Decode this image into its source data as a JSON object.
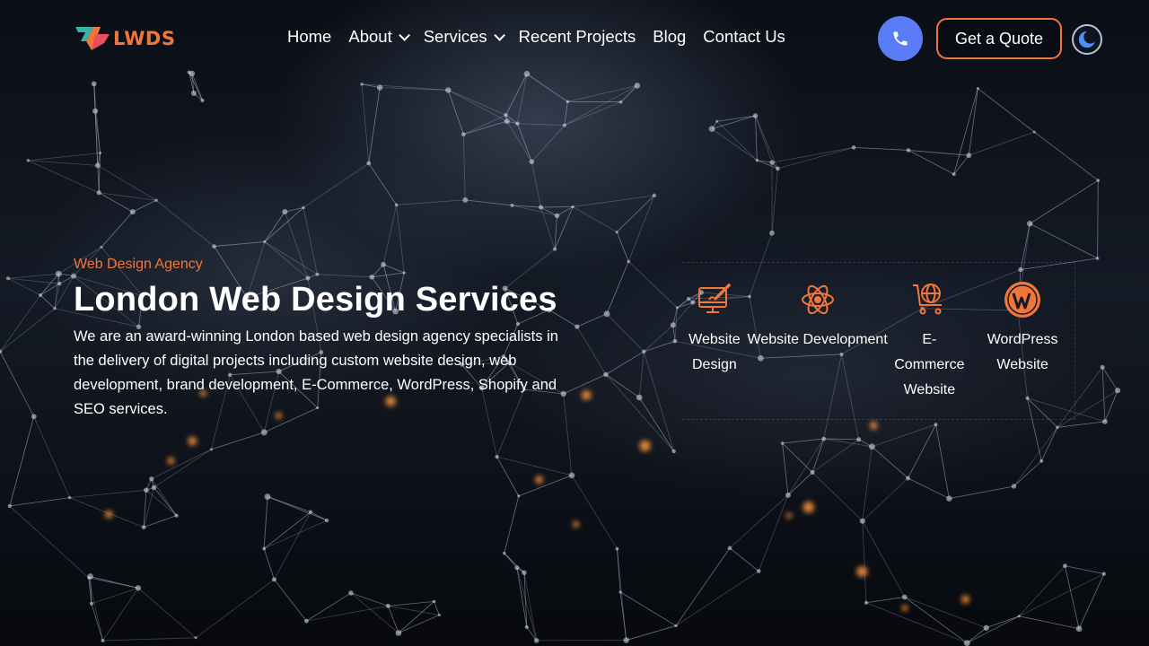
{
  "brand": {
    "name": "LWDS",
    "accent": "#f2763a",
    "phone_color": "#5a7cf6"
  },
  "nav": {
    "items": [
      {
        "label": "Home",
        "dropdown": false
      },
      {
        "label": "About",
        "dropdown": true
      },
      {
        "label": "Services",
        "dropdown": true
      },
      {
        "label": "Recent Projects",
        "dropdown": false
      },
      {
        "label": "Blog",
        "dropdown": false
      },
      {
        "label": "Contact Us",
        "dropdown": false
      }
    ]
  },
  "header": {
    "phone_icon": "phone-icon",
    "quote_label": "Get a Quote",
    "theme_icon": "moon-icon"
  },
  "hero": {
    "eyebrow": "Web Design Agency",
    "title": "London Web Design Services",
    "description": "We are an award-winning London based web design agency specialists in the delivery of digital projects including custom website design, web development, brand development, E-Commerce, WordPress, Shopify and SEO services."
  },
  "services": [
    {
      "label": "Website Design",
      "icon": "monitor-paintbrush-icon"
    },
    {
      "label": "Website Development",
      "icon": "atom-icon"
    },
    {
      "label": "E-Commerce Website",
      "icon": "cart-globe-icon"
    },
    {
      "label": "WordPress Website",
      "icon": "wordpress-icon"
    }
  ]
}
